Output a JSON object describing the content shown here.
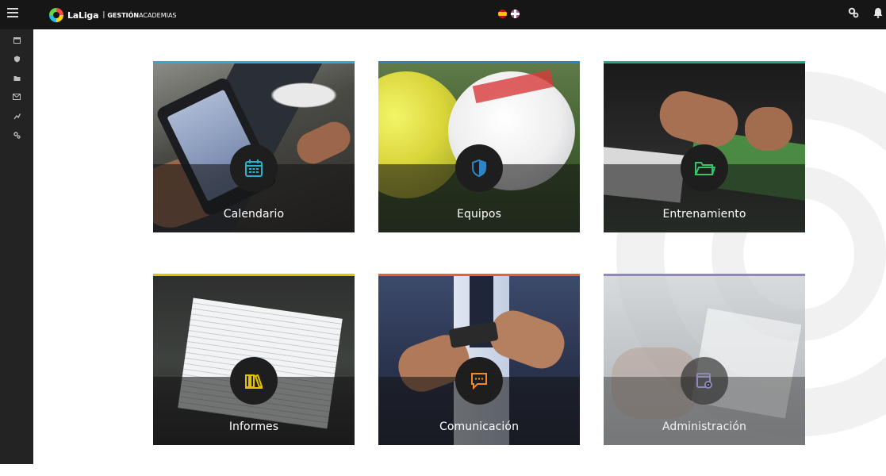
{
  "header": {
    "brand_name": "LaLiga",
    "brand_separator": "|",
    "brand_product_bold": "GESTIÓN",
    "brand_product_light": "ACADEMIAS",
    "icons": [
      "menu-icon",
      "spain-flag-icon",
      "english-flag-icon",
      "settings-gears-icon",
      "bell-icon"
    ]
  },
  "sidebar": {
    "items": [
      {
        "icon": "calendar-icon"
      },
      {
        "icon": "shield-icon"
      },
      {
        "icon": "folder-icon"
      },
      {
        "icon": "mail-icon"
      },
      {
        "icon": "chart-icon"
      },
      {
        "icon": "gears-icon"
      }
    ]
  },
  "tiles": [
    {
      "label": "Calendario",
      "icon": "calendar-icon",
      "accent": "#2ab0c9"
    },
    {
      "label": "Equipos",
      "icon": "shield-icon",
      "accent": "#2e84c4"
    },
    {
      "label": "Entrenamiento",
      "icon": "folder-icon",
      "accent": "#27a88a"
    },
    {
      "label": "Informes",
      "icon": "books-icon",
      "accent": "#e3c300"
    },
    {
      "label": "Comunicación",
      "icon": "chat-icon",
      "accent": "#e06236"
    },
    {
      "label": "Administración",
      "icon": "settings-window-icon",
      "accent": "#8f89b8"
    }
  ],
  "colors": {
    "topbar": "#161616",
    "sidebar": "#232323",
    "icon_cyan": "#2ab0c9",
    "icon_green": "#35c46a",
    "icon_yellow": "#e3c300",
    "icon_orange": "#f08a2a"
  }
}
